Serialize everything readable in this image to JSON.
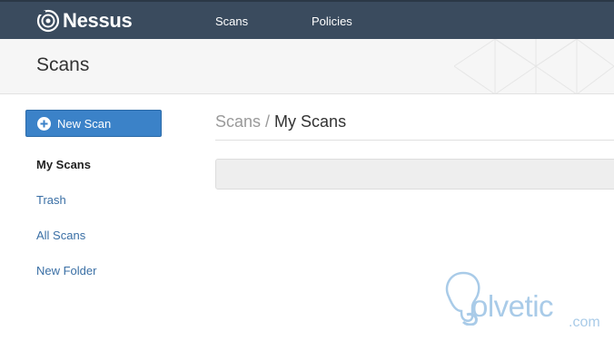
{
  "header": {
    "logo_text": "Nessus",
    "nav": [
      {
        "label": "Scans"
      },
      {
        "label": "Policies"
      }
    ]
  },
  "titlebar": {
    "title": "Scans"
  },
  "sidebar": {
    "new_scan_label": "New Scan",
    "items": [
      {
        "label": "My Scans",
        "active": true
      },
      {
        "label": "Trash"
      },
      {
        "label": "All Scans"
      },
      {
        "label": "New Folder"
      }
    ]
  },
  "main": {
    "breadcrumb": {
      "root": "Scans",
      "separator": "/",
      "current": "My Scans"
    }
  },
  "watermark": {
    "text": "olvetic",
    "suffix": ".com"
  },
  "colors": {
    "header_bg": "#3a4b5e",
    "primary_button": "#3b82c8",
    "link": "#3a6fa5",
    "watermark": "#a9cbe8"
  }
}
